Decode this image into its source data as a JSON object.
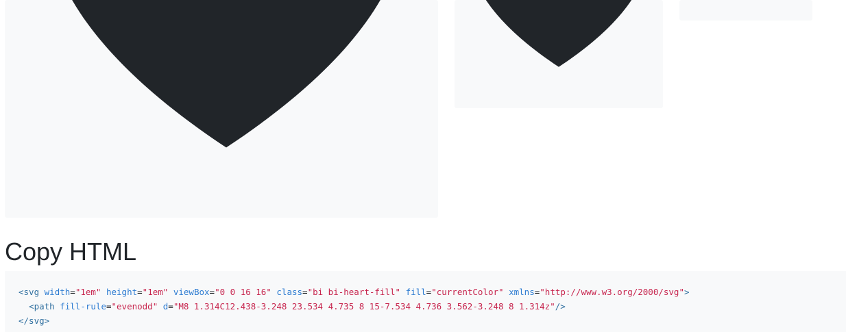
{
  "heading": "Copy HTML",
  "icon": {
    "name": "heart-fill-icon",
    "fill_color": "#212529",
    "preview_background": "#f8f9fa"
  },
  "code": {
    "line1": {
      "open": "<svg",
      "attr_width": "width",
      "val_width": "\"1em\"",
      "attr_height": "height",
      "val_height": "\"1em\"",
      "attr_viewbox": "viewBox",
      "val_viewbox": "\"0 0 16 16\"",
      "attr_class": "class",
      "val_class": "\"bi bi-heart-fill\"",
      "attr_fill": "fill",
      "val_fill": "\"currentColor\"",
      "attr_xmlns": "xmlns",
      "val_xmlns": "\"http://www.w3.org/2000/svg\"",
      "close": ">"
    },
    "line2": {
      "indent": "  ",
      "open": "<path",
      "attr_fillrule": "fill-rule",
      "val_fillrule": "\"evenodd\"",
      "attr_d": "d",
      "val_d": "\"M8 1.314C12.438-3.248 23.534 4.735 8 15-7.534 4.736 3.562-3.248 8 1.314z\"",
      "close": "/>"
    },
    "line3": {
      "close": "</svg>"
    }
  }
}
